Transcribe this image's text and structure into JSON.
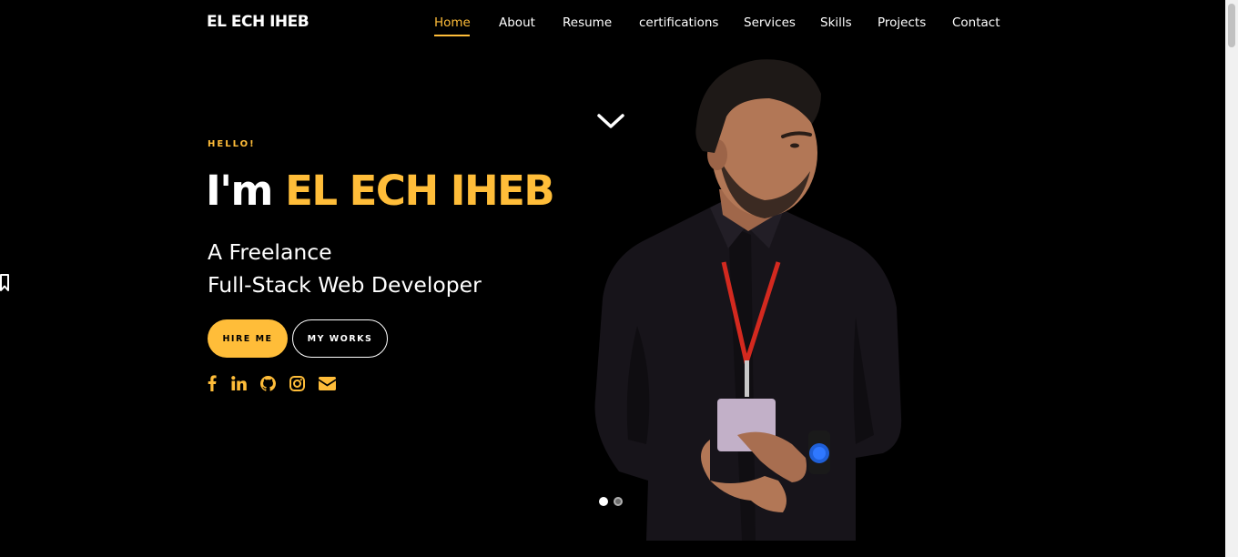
{
  "brand": {
    "name": "EL ECH IHEB"
  },
  "nav": {
    "items": [
      "Home",
      "About",
      "Resume",
      "certifications",
      "Services",
      "Skills",
      "Projects",
      "Contact"
    ],
    "active": "Home"
  },
  "hero": {
    "greeting": "HELLO!",
    "headline_prefix": "I'm",
    "headline_name": "EL ECH IHEB",
    "subtitle_line1": "A Freelance",
    "subtitle_line2": "Full-Stack Web Developer",
    "buttons": {
      "hire": "HIRE ME",
      "works": "MY WORKS"
    },
    "social_icons": [
      "facebook-icon",
      "linkedin-icon",
      "github-icon",
      "instagram-icon",
      "envelope-icon"
    ]
  },
  "carousel": {
    "slides": 2,
    "active_slide": 1
  },
  "colors": {
    "accent": "#ffbd39",
    "background": "#000000",
    "text": "#ffffff"
  }
}
